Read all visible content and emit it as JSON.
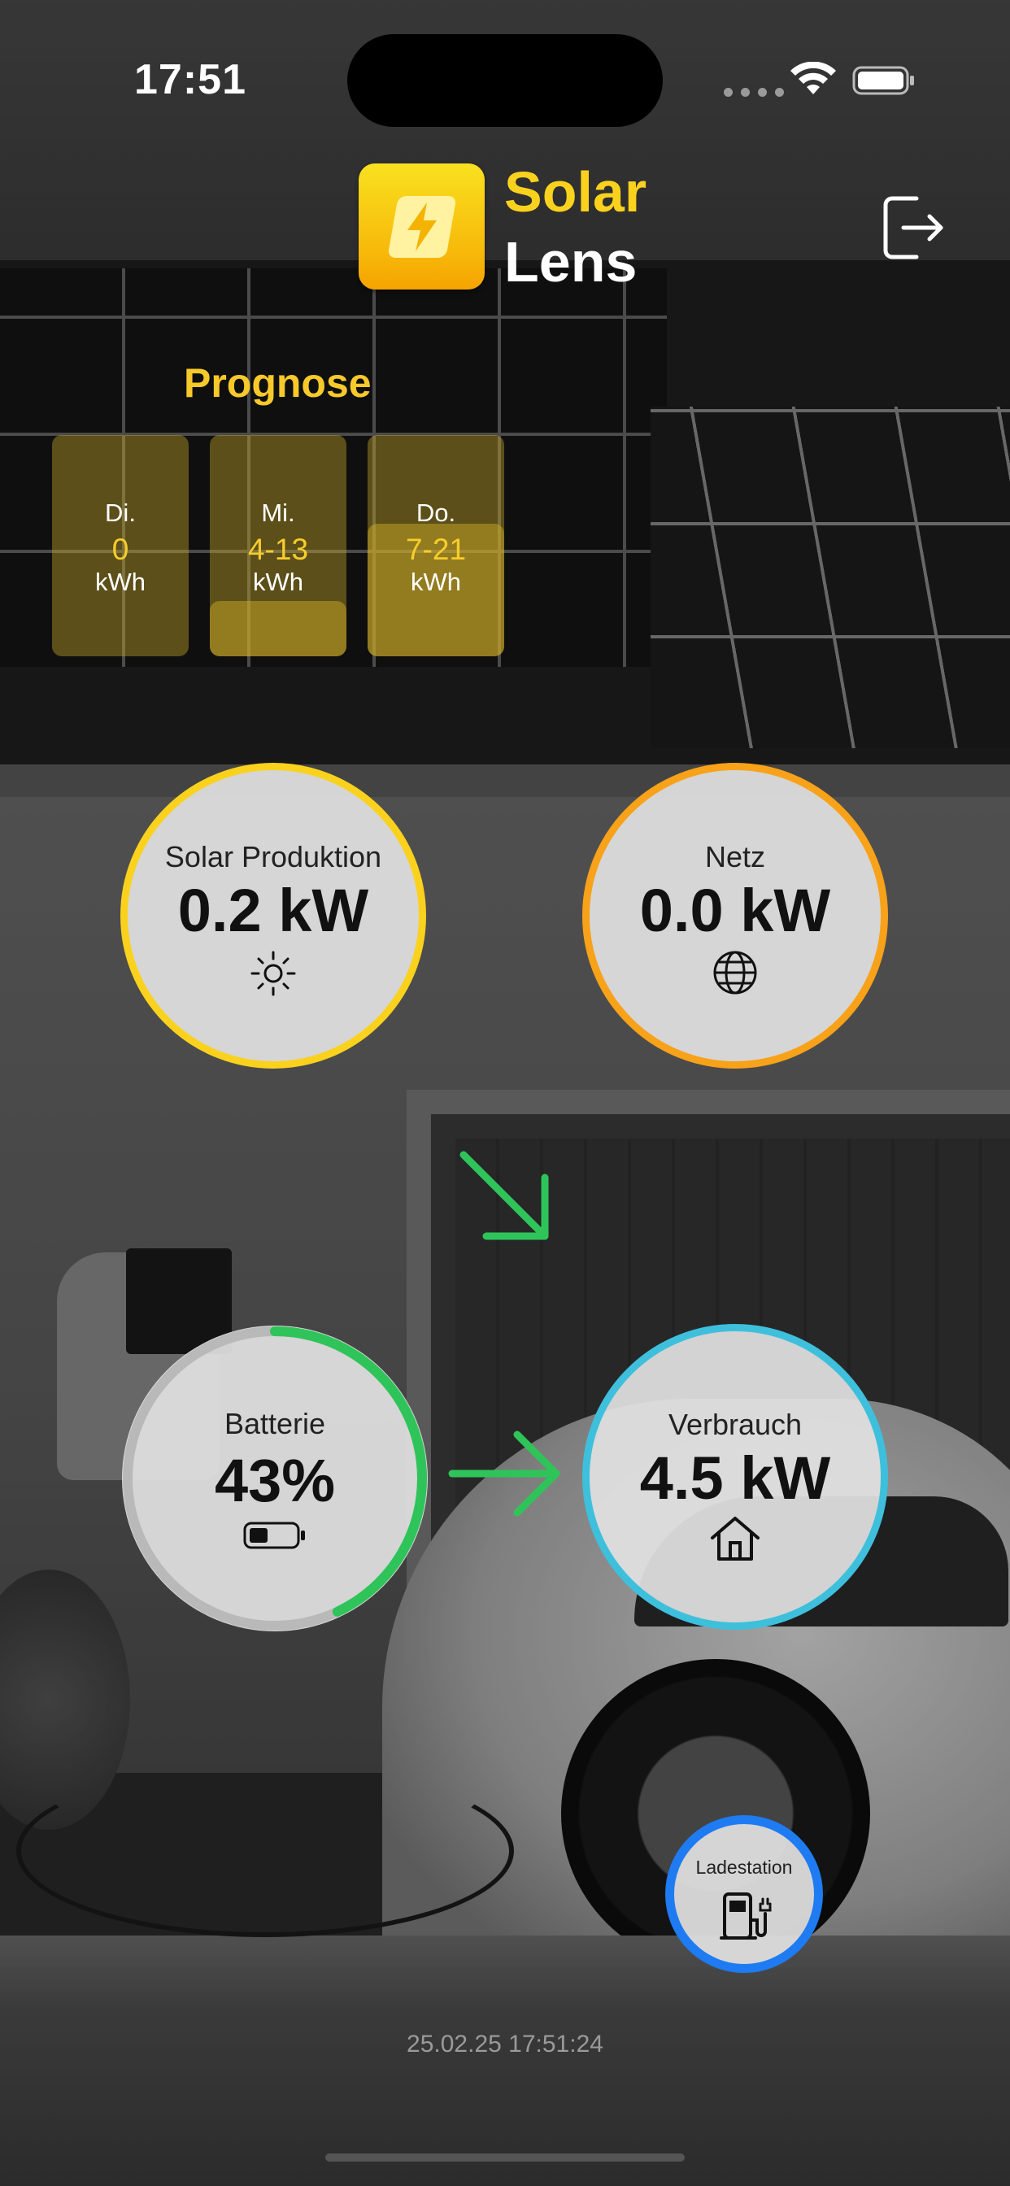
{
  "status_bar": {
    "time": "17:51",
    "icons": [
      "cellular-dots-icon",
      "wifi-icon",
      "battery-icon"
    ]
  },
  "header": {
    "app_name_line1": "Solar",
    "app_name_line2": "Lens",
    "logo_icon": "lightning-bolt-icon",
    "logout_icon": "logout-icon",
    "accent_color": "#fad21e"
  },
  "forecast": {
    "title": "Prognose",
    "days": [
      {
        "day": "Di.",
        "value": "0",
        "unit": "kWh",
        "fill_fraction": 0.0
      },
      {
        "day": "Mi.",
        "value": "4-13",
        "unit": "kWh",
        "fill_fraction": 0.25
      },
      {
        "day": "Do.",
        "value": "7-21",
        "unit": "kWh",
        "fill_fraction": 0.6
      }
    ]
  },
  "tiles": {
    "solar": {
      "label": "Solar Produktion",
      "value": "0.2 kW",
      "icon": "sun-icon",
      "color": "#fad21e"
    },
    "grid": {
      "label": "Netz",
      "value": "0.0 kW",
      "icon": "globe-icon",
      "color": "#f8a21a"
    },
    "battery": {
      "label": "Batterie",
      "value": "43%",
      "icon": "battery-level-icon",
      "level_percent": 43,
      "color": "#2fc45a"
    },
    "consumption": {
      "label": "Verbrauch",
      "value": "4.5 kW",
      "icon": "house-icon",
      "color": "#3ec0dc"
    }
  },
  "flows": {
    "solar_to_consumption": {
      "icon": "arrow-down-right-icon",
      "color": "#2fc45a"
    },
    "battery_to_consumption": {
      "icon": "arrow-right-icon",
      "color": "#2fc45a"
    }
  },
  "charging_station": {
    "label": "Ladestation",
    "icon": "ev-charger-icon",
    "color": "#1f7bf2"
  },
  "footer": {
    "timestamp": "25.02.25 17:51:24"
  }
}
